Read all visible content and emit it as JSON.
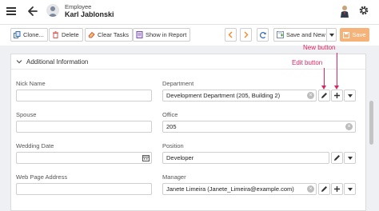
{
  "header": {
    "entity_label": "Employee",
    "entity_name": "Karl Jablonski"
  },
  "toolbar": {
    "clone_label": "Clone...",
    "delete_label": "Delete",
    "clear_tasks_label": "Clear Tasks",
    "show_in_report_label": "Show in Report",
    "save_and_new_label": "Save and New",
    "save_label": "Save"
  },
  "section": {
    "title": "Additional Information"
  },
  "fields": {
    "nick_name": {
      "label": "Nick Name",
      "value": ""
    },
    "department": {
      "label": "Department",
      "value": "Development Department (205, Building 2)"
    },
    "spouse": {
      "label": "Spouse",
      "value": ""
    },
    "office": {
      "label": "Office",
      "value": "205"
    },
    "wedding_date": {
      "label": "Wedding Date",
      "value": ""
    },
    "position": {
      "label": "Position",
      "value": "Developer"
    },
    "web_page_address": {
      "label": "Web Page Address",
      "value": ""
    },
    "manager": {
      "label": "Manager",
      "value": "Janete Limeira (Janete_Limeira@example.com)"
    }
  },
  "annotations": {
    "new_button": "New button",
    "edit_button": "Edit button"
  },
  "colors": {
    "accent": "#f5b37a",
    "annotation": "#e0245e",
    "nav_arrow": "#f08a24"
  }
}
